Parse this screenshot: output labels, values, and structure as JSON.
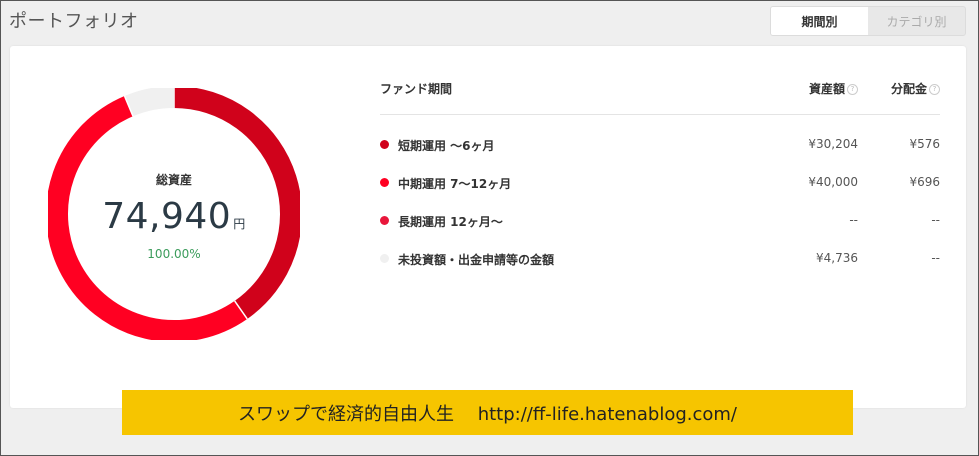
{
  "title": "ポートフォリオ",
  "tabs": [
    {
      "label": "期間別",
      "active": true
    },
    {
      "label": "カテゴリ別",
      "active": false
    }
  ],
  "summary": {
    "label": "総資産",
    "amount": "74,940",
    "unit": "円",
    "percent": "100.00%"
  },
  "table": {
    "headers": {
      "name": "ファンド期間",
      "assets": "資産額",
      "distribution": "分配金",
      "help_icon": "?"
    },
    "rows": [
      {
        "name": "短期運用 〜6ヶ月",
        "assets": "¥30,204",
        "distribution": "¥576",
        "color": "#d0021b"
      },
      {
        "name": "中期運用 7〜12ヶ月",
        "assets": "¥40,000",
        "distribution": "¥696",
        "color": "#ff0022"
      },
      {
        "name": "長期運用 12ヶ月〜",
        "assets": "--",
        "distribution": "--",
        "color": "#e8173b"
      },
      {
        "name": "未投資額・出金申請等の金額",
        "assets": "¥4,736",
        "distribution": "--",
        "color": "#f0f0f0"
      }
    ]
  },
  "chart_data": {
    "type": "pie",
    "categories": [
      "短期運用 〜6ヶ月",
      "中期運用 7〜12ヶ月",
      "長期運用 12ヶ月〜",
      "未投資額・出金申請等の金額"
    ],
    "values": [
      30204,
      40000,
      0,
      4736
    ],
    "colors": [
      "#d0021b",
      "#ff0022",
      "#e8173b",
      "#f0f0f0"
    ]
  },
  "banner": {
    "text": "スワップで経済的自由人生　 http://ff-life.hatenablog.com/"
  }
}
